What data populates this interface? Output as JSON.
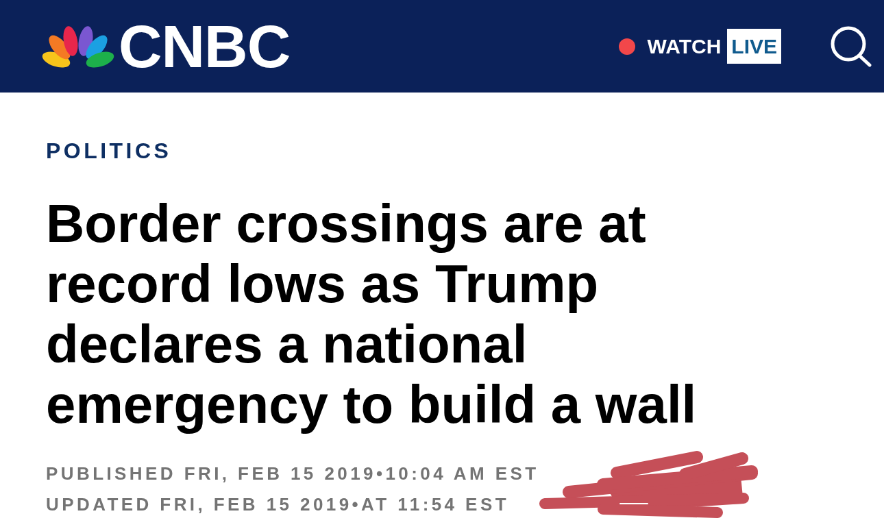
{
  "header": {
    "logo_text": "CNBC",
    "watch_live": {
      "label": "WATCH",
      "badge": "LIVE"
    }
  },
  "article": {
    "section": "POLITICS",
    "headline": "Border crossings are at record lows as Trump declares a national emergency to build a wall",
    "timestamps": [
      "PUBLISHED FRI, FEB 15 2019•10:04 AM EST",
      "UPDATED FRI, FEB 15 2019•AT 11:54 EST"
    ]
  }
}
